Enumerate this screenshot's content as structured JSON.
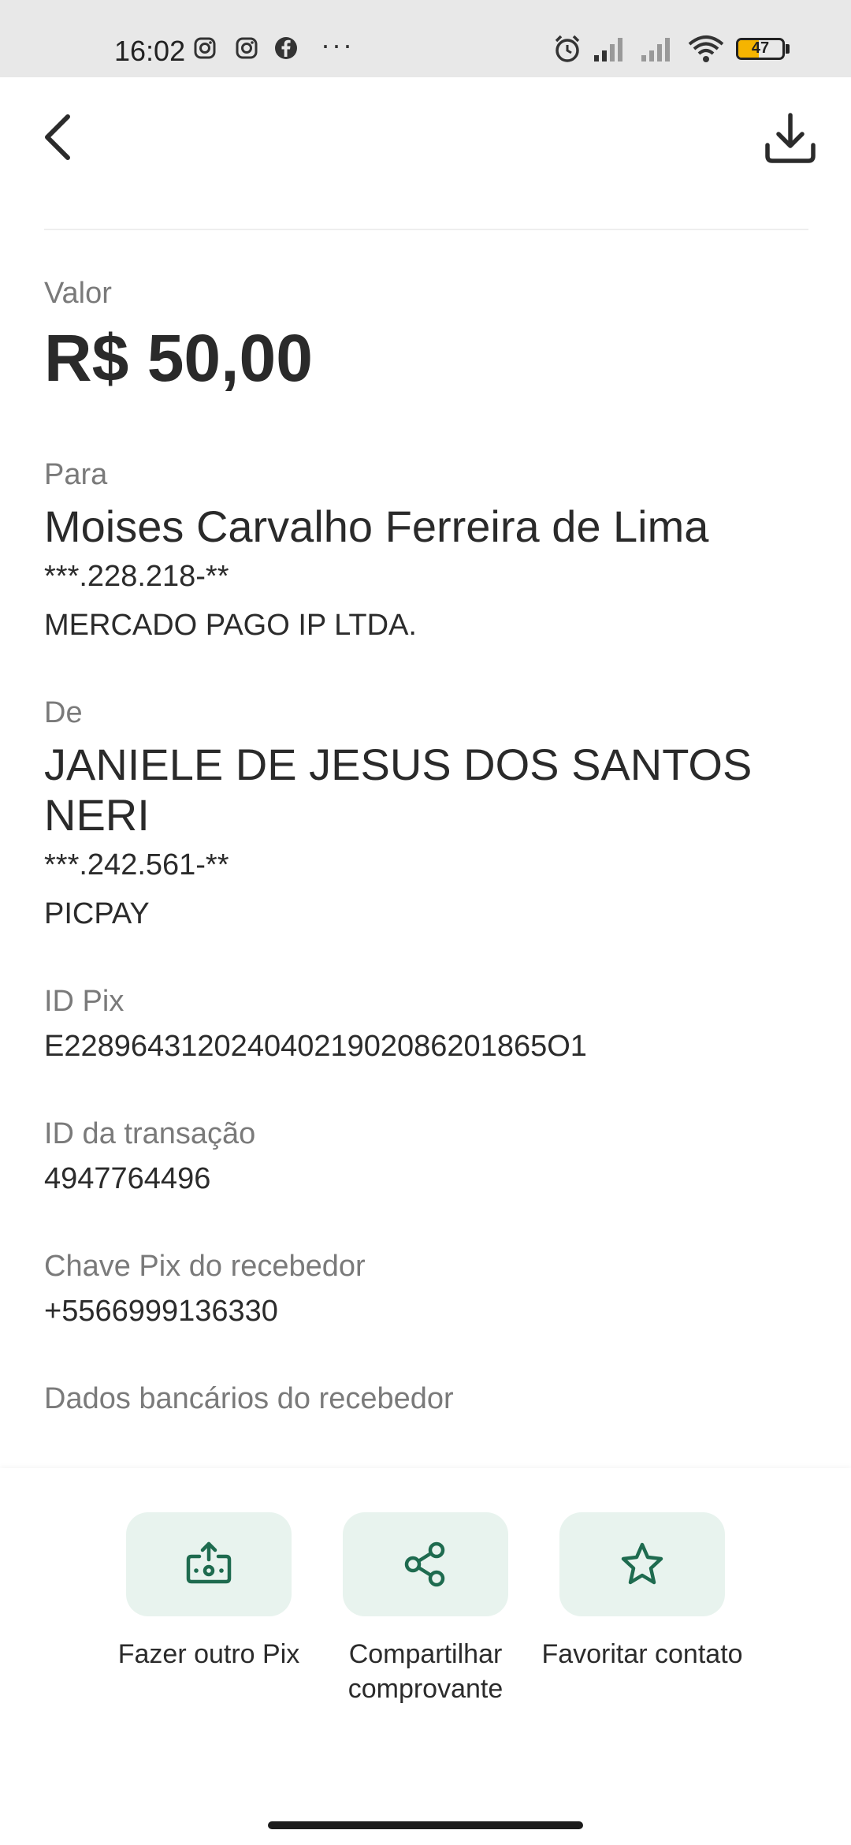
{
  "status_bar": {
    "time": "16:02",
    "battery": "47",
    "battery_level": 0.47,
    "battery_color": "#f5b400",
    "left_icons": [
      "instagram-icon",
      "instagram-icon",
      "facebook-icon",
      "more-dots-icon"
    ],
    "right_icons": [
      "alarm-icon",
      "signal-icon",
      "signal-icon",
      "wifi-icon",
      "battery-icon"
    ],
    "more": "···"
  },
  "header": {
    "back_icon": "chevron-left-icon",
    "download_icon": "download-icon"
  },
  "receipt": {
    "valor_label": "Valor",
    "valor": "R$ 50,00",
    "para_label": "Para",
    "para_name": "Moises Carvalho Ferreira de Lima",
    "para_doc": "***.228.218-**",
    "para_bank": "MERCADO PAGO IP LTDA.",
    "de_label": "De",
    "de_name": "JANIELE DE JESUS DOS SANTOS NERI",
    "de_doc": "***.242.561-**",
    "de_bank": "PICPAY",
    "id_pix_label": "ID Pix",
    "id_pix": "E22896431202404021902086201865O1",
    "id_transacao_label": "ID da transação",
    "id_transacao": "4947764496",
    "chave_label": "Chave Pix do recebedor",
    "chave": "+5566999136330",
    "dados_label": "Dados bancários do recebedor"
  },
  "actions": [
    {
      "label": "Fazer outro Pix",
      "icon": "money-upload-icon"
    },
    {
      "label": "Compartilhar comprovante",
      "icon": "share-icon"
    },
    {
      "label": "Favoritar contato",
      "icon": "star-icon"
    }
  ],
  "colors": {
    "accent": "#1e6b4f",
    "action_bg": "#e8f3ee"
  }
}
